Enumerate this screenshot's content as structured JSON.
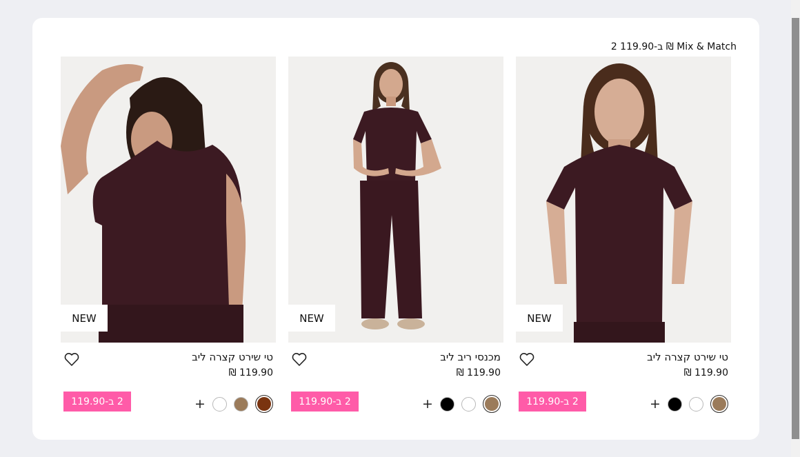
{
  "banner": {
    "text": "2 ב-119.90 ₪ Mix & Match"
  },
  "colors": {
    "promo_bg": "#ff5ba8",
    "garment": "#3c1a22",
    "skin": "#c99a80",
    "hair": "#2a1a14"
  },
  "products": [
    {
      "title": "טי שירט קצרה ליב",
      "price": "119.90 ₪",
      "badge": "NEW",
      "promo": "2 ב-119.90",
      "more": "+",
      "swatches": [
        {
          "name": "brown-rust",
          "color": "#7a3410",
          "selected": true
        },
        {
          "name": "tan",
          "color": "#9b7b5a",
          "selected": false
        },
        {
          "name": "white",
          "color": "#ffffff",
          "selected": false
        }
      ]
    },
    {
      "title": "מכנסי ריב ליב",
      "price": "119.90 ₪",
      "badge": "NEW",
      "promo": "2 ב-119.90",
      "more": "+",
      "swatches": [
        {
          "name": "tan",
          "color": "#9b7b5a",
          "selected": true
        },
        {
          "name": "white",
          "color": "#ffffff",
          "selected": false
        },
        {
          "name": "black",
          "color": "#000000",
          "selected": false
        }
      ]
    },
    {
      "title": "טי שירט קצרה ליב",
      "price": "119.90 ₪",
      "badge": "NEW",
      "promo": "2 ב-119.90",
      "more": "+",
      "swatches": [
        {
          "name": "tan",
          "color": "#9b7b5a",
          "selected": true
        },
        {
          "name": "white",
          "color": "#ffffff",
          "selected": false
        },
        {
          "name": "black",
          "color": "#000000",
          "selected": false
        }
      ]
    }
  ]
}
